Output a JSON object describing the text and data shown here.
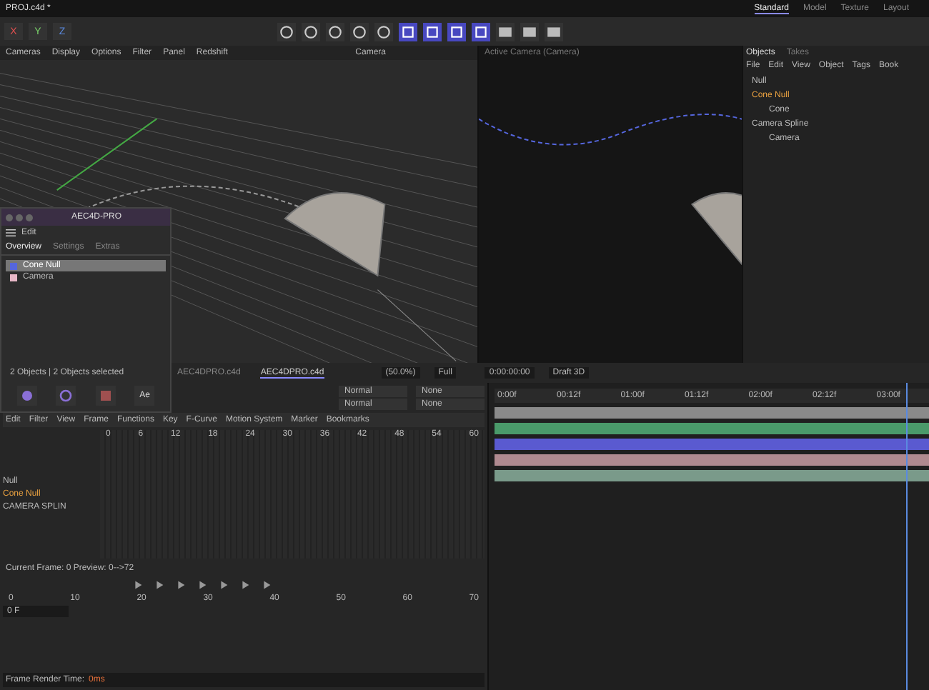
{
  "file_tab": {
    "label": "PROJ.c4d *"
  },
  "layouts": [
    {
      "label": "Standard",
      "selected": true
    },
    {
      "label": "Model",
      "selected": false
    },
    {
      "label": "Texture",
      "selected": false
    },
    {
      "label": "Layout",
      "selected": false
    }
  ],
  "axis_buttons": [
    {
      "label": "X",
      "color": "#e05050"
    },
    {
      "label": "Y",
      "color": "#7ad36a"
    },
    {
      "label": "Z",
      "color": "#5a8ae0"
    }
  ],
  "viewport_menu": [
    "Cameras",
    "Display",
    "Options",
    "Filter",
    "Panel",
    "Redshift"
  ],
  "left_viewport": {
    "camera_label": "Camera"
  },
  "right_viewport": {
    "title": "Active Camera (Camera)"
  },
  "objects": {
    "tabs": [
      {
        "label": "Objects",
        "selected": true
      },
      {
        "label": "Takes",
        "selected": false
      }
    ],
    "menu": [
      "File",
      "Edit",
      "View",
      "Object",
      "Tags",
      "Book"
    ],
    "tree": [
      {
        "name": "Null",
        "selected": false
      },
      {
        "name": "Cone Null",
        "selected": true,
        "children": [
          {
            "name": "Cone",
            "selected": false
          }
        ]
      },
      {
        "name": "Camera Spline",
        "selected": false,
        "children": [
          {
            "name": "Camera",
            "selected": false
          }
        ]
      }
    ]
  },
  "plugin": {
    "title": "AEC4D-PRO",
    "menu": "Edit",
    "tabs": [
      {
        "label": "Overview",
        "selected": true
      },
      {
        "label": "Settings",
        "selected": false
      },
      {
        "label": "Extras",
        "selected": false
      }
    ],
    "items": [
      {
        "name": "Cone Null",
        "color": "#5566dd",
        "selected": true
      },
      {
        "name": "Camera",
        "color": "#e8b8c8",
        "selected": false
      }
    ],
    "summary": "2 Objects | 2 Objects selected",
    "buttons": [
      {
        "kind": "import"
      },
      {
        "kind": "sync"
      },
      {
        "kind": "export"
      },
      {
        "kind": "text",
        "label": "Ae"
      }
    ]
  },
  "viewer_bar": {
    "zoom": "(50.0%)",
    "quality": "Full",
    "timecode": "0:00:00:00",
    "renderer": "Draft 3D"
  },
  "ae_tabs": [
    {
      "label": "AEC4DPRO.c4d",
      "selected": false
    },
    {
      "label": "AEC4DPRO.c4d",
      "selected": true
    }
  ],
  "timeline_menu": [
    "Edit",
    "Filter",
    "View",
    "Frame",
    "Functions",
    "Key",
    "F-Curve",
    "Motion System",
    "Marker",
    "Bookmarks"
  ],
  "blend_rows": [
    {
      "mode": "Normal",
      "matte": "None"
    },
    {
      "mode": "Normal",
      "matte": "None"
    }
  ],
  "frame_ticks": [
    "0",
    "6",
    "12",
    "18",
    "24",
    "30",
    "36",
    "42",
    "48",
    "54",
    "60"
  ],
  "tracks": [
    {
      "name": "Null",
      "selected": false
    },
    {
      "name": "Cone Null",
      "selected": true
    },
    {
      "name": "CAMERA SPLIN",
      "selected": false
    }
  ],
  "preview_label": "Current Frame: 0  Preview: 0-->72",
  "bottom_ticks": [
    "0",
    "10",
    "20",
    "30",
    "40",
    "50",
    "60",
    "70"
  ],
  "frame_field": "0 F",
  "status": {
    "label": "Frame Render Time:",
    "value": "0ms"
  },
  "ae_ruler": [
    "0:00f",
    "00:12f",
    "01:00f",
    "01:12f",
    "02:00f",
    "02:12f",
    "03:00f"
  ],
  "ae_layers": [
    {
      "color": "#8a8a8a"
    },
    {
      "color": "#4a9a6a"
    },
    {
      "color": "#5a5ad0"
    },
    {
      "color": "#b08a90"
    },
    {
      "color": "#7a9a8a"
    }
  ]
}
